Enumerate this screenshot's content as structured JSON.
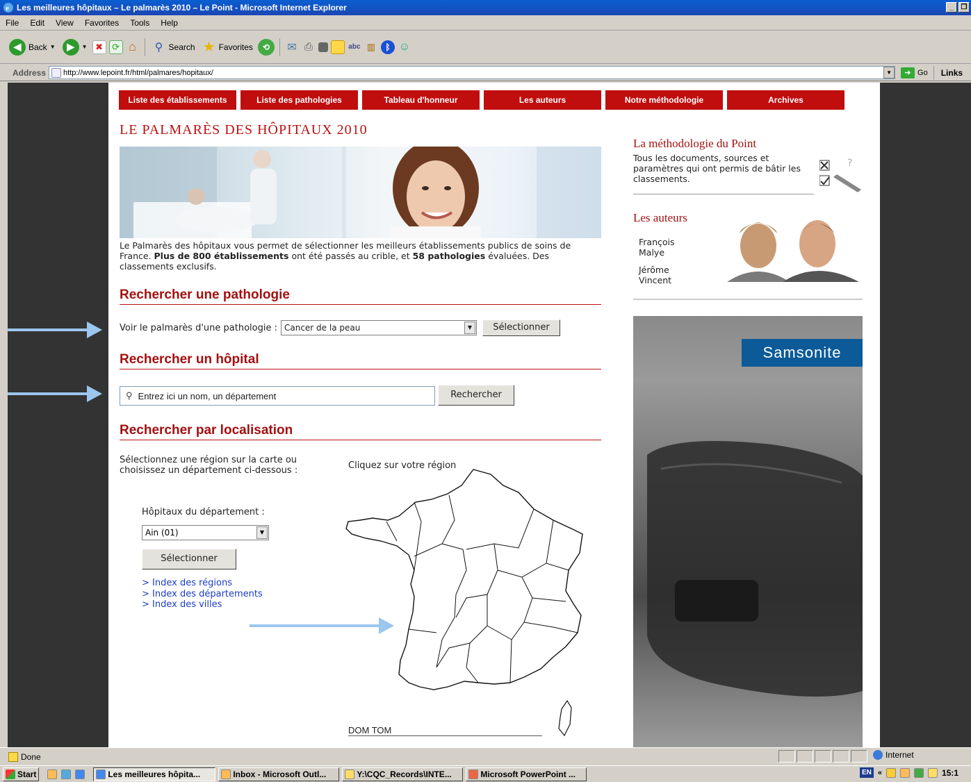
{
  "window": {
    "title": "Les meilleures hôpitaux – Le palmarès 2010 – Le Point - Microsoft Internet Explorer"
  },
  "menu": [
    "File",
    "Edit",
    "View",
    "Favorites",
    "Tools",
    "Help"
  ],
  "toolbar": {
    "back": "Back",
    "search": "Search",
    "favorites": "Favorites"
  },
  "address": {
    "label": "Address",
    "url": "http://www.lepoint.fr/html/palmares/hopitaux/",
    "go": "Go",
    "links": "Links"
  },
  "site": {
    "nav": [
      "Liste des établissements",
      "Liste des pathologies",
      "Tableau d'honneur",
      "Les auteurs",
      "Notre méthodologie",
      "Archives"
    ],
    "title": "LE PALMARÈS DES HÔPITAUX 2010",
    "intro_1": "Le Palmarès des hôpitaux vous permet de sélectionner les meilleurs établissements publics de soins de France. ",
    "intro_bold_1": "Plus de 800 établissements",
    "intro_2": " ont été passés au crible, et ",
    "intro_bold_2": "58 pathologies",
    "intro_3": " évaluées. Des classements exclusifs.",
    "patho": {
      "heading": "Rechercher une pathologie",
      "label": "Voir le palmarès d'une pathologie :",
      "selected": "Cancer de la peau",
      "button": "Sélectionner"
    },
    "hopital": {
      "heading": "Rechercher un hôpital",
      "placeholder": "Entrez ici un nom, un département",
      "button": "Rechercher"
    },
    "localisation": {
      "heading": "Rechercher par localisation",
      "instructions_1": "Sélectionnez une région sur la carte ou",
      "instructions_2": "choisissez un département ci-dessous :",
      "dep_label": "Hôpitaux du département :",
      "dep_selected": "Ain (01)",
      "button": "Sélectionner",
      "links": [
        "> Index des régions",
        "> Index des départements",
        "> Index des villes"
      ],
      "map_caption": "Cliquez sur votre région",
      "domtom": "DOM TOM"
    },
    "sidebar": {
      "meth_title": "La méthodologie du Point",
      "meth_text": "Tous les documents, sources et paramètres qui ont permis de bâtir les classements.",
      "authors_title": "Les auteurs",
      "author1_first": "François",
      "author1_last": "Malye",
      "author2_first": "Jérôme",
      "author2_last": "Vincent"
    },
    "ad_brand": "Samsonite"
  },
  "status": {
    "text": "Done",
    "zone": "Internet"
  },
  "taskbar": {
    "start": "Start",
    "items": [
      "Les meilleures hôpita...",
      "Inbox - Microsoft Outl...",
      "Y:\\CQC_Records\\INTE...",
      "Microsoft PowerPoint ..."
    ],
    "lang": "EN",
    "clock": "15:1"
  },
  "colors": {
    "brand_red": "#c00e0e",
    "heading_red": "#a31010",
    "arrow_blue": "#9dc6ee",
    "link_blue": "#1a3cc9"
  }
}
